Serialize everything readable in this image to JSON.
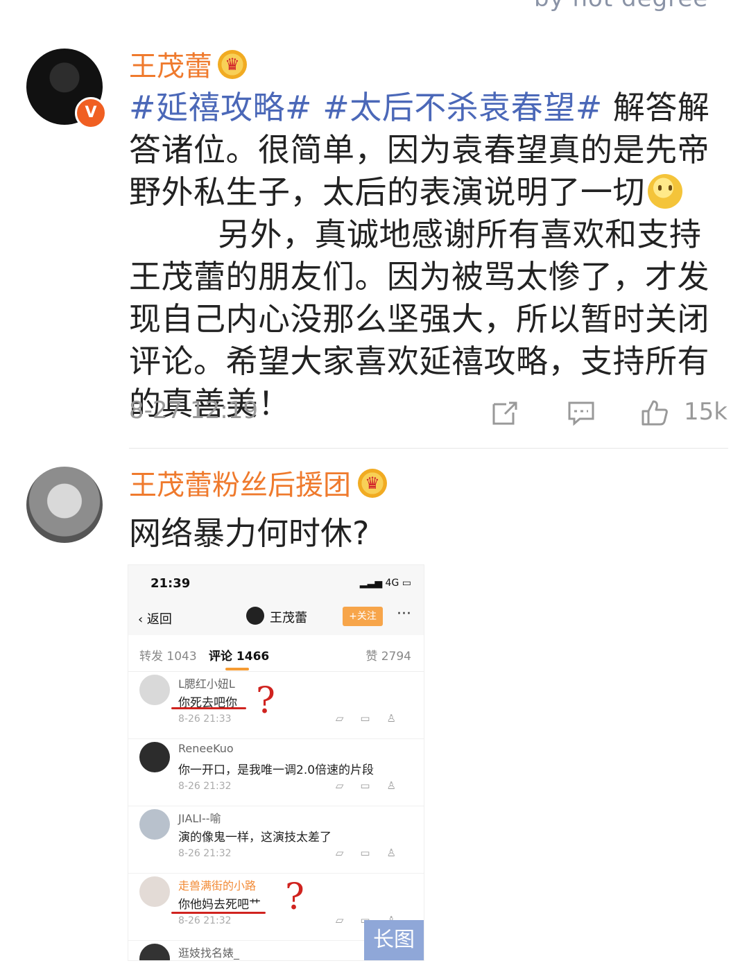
{
  "watermark": "by hot degree",
  "post": {
    "author": "王茂蕾",
    "verified_mark": "V",
    "crown_icon": "crown-icon",
    "topics": [
      "#延禧攻略#",
      "#太后不杀袁春望#"
    ],
    "text_before_smile": " 解答解答诸位。很简单，因为袁春望真的是先帝野外私生子，太后的表演说明了一切",
    "text_after_smile": "另外，真诚地感谢所有喜欢和支持王茂蕾的朋友们。因为被骂太惨了，才发现自己内心没那么坚强大，所以暂时关闭评论。希望大家喜欢延禧攻略，支持所有的真善美！",
    "time": "8-27 12:19",
    "likes": "15k"
  },
  "comment": {
    "author": "王茂蕾粉丝后援团",
    "text": "网络暴力何时休?",
    "long_image_label": "长图"
  },
  "screenshot": {
    "time": "21:39",
    "network": "4G",
    "back_label": "返回",
    "user_name": "王茂蕾",
    "follow_label": "+关注",
    "more_label": "···",
    "tabs": {
      "repost": "转发 1043",
      "comments": "评论 1466",
      "likes": "赞 2794"
    },
    "rows": [
      {
        "name": "L腮红小妞L",
        "text": "你死去吧你",
        "time": "8-26 21:33"
      },
      {
        "name": "ReneeKuo",
        "text": "你一开口，是我唯一调2.0倍速的片段",
        "time": "8-26 21:32"
      },
      {
        "name": "JIALI--喻",
        "text": "演的像鬼一样，这演技太差了",
        "time": "8-26 21:32"
      },
      {
        "name": "走兽满街的小路",
        "text": "你他妈去死吧艹",
        "time": "8-26 21:32"
      },
      {
        "name": "逛妓找名婊_",
        "text": "",
        "time": ""
      }
    ]
  }
}
